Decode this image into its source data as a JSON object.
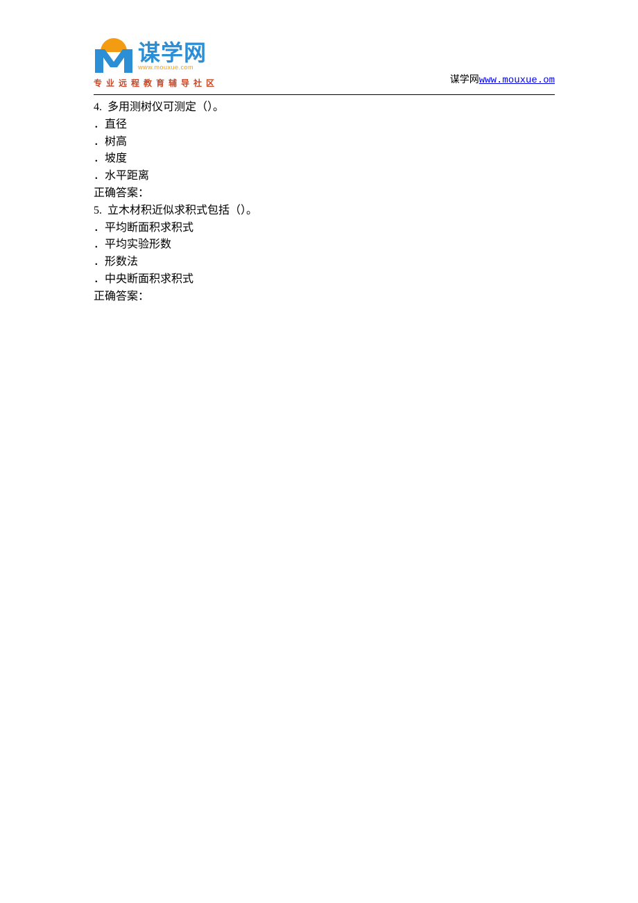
{
  "header": {
    "logo_brand": "谋学网",
    "logo_url": "www.mouxue.com",
    "logo_tagline": "专业远程教育辅导社区",
    "right_label": "谋学网",
    "right_link_text": "www.mouxue.om"
  },
  "questions": [
    {
      "number": "4.",
      "stem": "多用测树仪可测定（）。",
      "options": [
        "直径",
        "树高",
        "坡度",
        "水平距离"
      ],
      "answer_label": "正确答案："
    },
    {
      "number": "5.",
      "stem": "立木材积近似求积式包括（）。",
      "options": [
        "平均断面积求积式",
        "平均实验形数",
        "形数法",
        "中央断面积求积式"
      ],
      "answer_label": "正确答案："
    }
  ]
}
